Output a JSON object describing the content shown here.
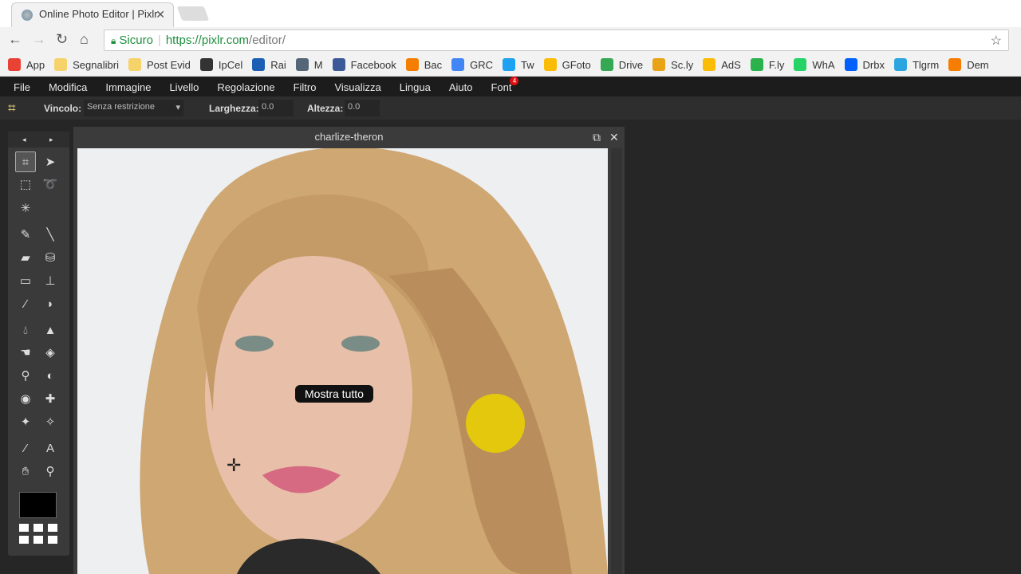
{
  "browser": {
    "tab_title": "Online Photo Editor | Pixlr",
    "secure_label": "Sicuro",
    "url_host": "https://pixlr.com",
    "url_path": "/editor/",
    "bookmarks": [
      {
        "label": "App",
        "color": "#e94235"
      },
      {
        "label": "Segnalibri",
        "color": "#f6d36a"
      },
      {
        "label": "Post Evid",
        "color": "#f6d36a"
      },
      {
        "label": "IpCel",
        "color": "#333333"
      },
      {
        "label": "Rai",
        "color": "#1a5fb4"
      },
      {
        "label": "M",
        "color": "#556677"
      },
      {
        "label": "Facebook",
        "color": "#3b5998"
      },
      {
        "label": "Bac",
        "color": "#f57d00"
      },
      {
        "label": "GRC",
        "color": "#4285f4"
      },
      {
        "label": "Tw",
        "color": "#1da1f2"
      },
      {
        "label": "GFoto",
        "color": "#fbbc05"
      },
      {
        "label": "Drive",
        "color": "#34a853"
      },
      {
        "label": "Sc.ly",
        "color": "#e8a317"
      },
      {
        "label": "AdS",
        "color": "#fbbc05"
      },
      {
        "label": "F.ly",
        "color": "#2bb24c"
      },
      {
        "label": "WhA",
        "color": "#25d366"
      },
      {
        "label": "Drbx",
        "color": "#0061ff"
      },
      {
        "label": "Tlgrm",
        "color": "#2ca5e0"
      },
      {
        "label": "Dem",
        "color": "#f57d00"
      }
    ]
  },
  "menu": {
    "items": [
      "File",
      "Modifica",
      "Immagine",
      "Livello",
      "Regolazione",
      "Filtro",
      "Visualizza",
      "Lingua",
      "Aiuto",
      "Font"
    ],
    "font_badge": "4"
  },
  "options": {
    "constraint_label": "Vincolo:",
    "constraint_value": "Senza restrizione",
    "width_label": "Larghezza:",
    "width_value": "0.0",
    "height_label": "Altezza:",
    "height_value": "0.0"
  },
  "document": {
    "title": "charlize-theron",
    "tooltip": "Mostra tutto"
  },
  "colors": {
    "primary_swatch": "#000000",
    "highlight": "#ebd200"
  }
}
